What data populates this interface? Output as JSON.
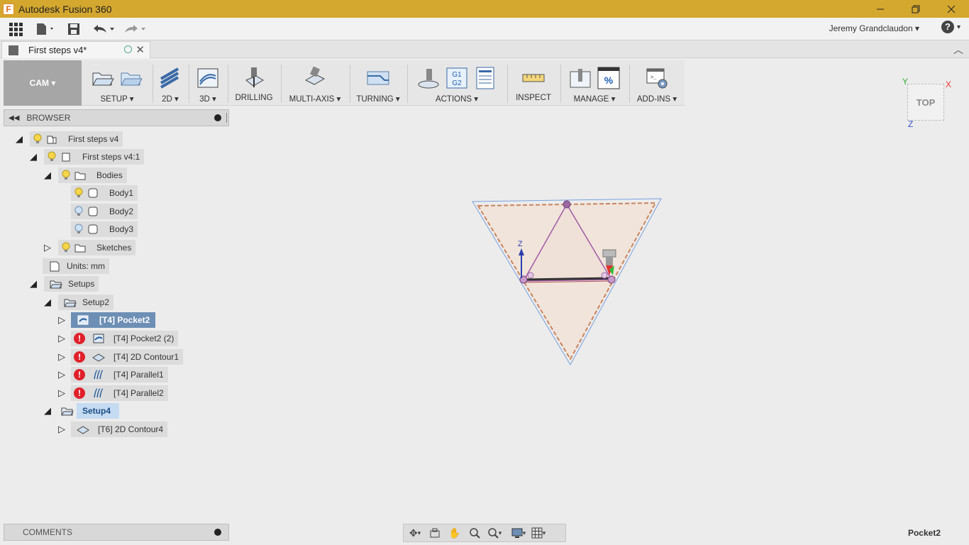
{
  "window": {
    "app_title": "Autodesk Fusion 360",
    "app_icon_letter": "F"
  },
  "quick_access": {
    "user_name": "Jeremy Grandclaudon",
    "help_label": "?"
  },
  "document_tab": {
    "name": "First steps v4*"
  },
  "toolbar": {
    "workspace": "CAM",
    "groups": [
      "SETUP",
      "2D",
      "3D",
      "DRILLING",
      "MULTI-AXIS",
      "TURNING",
      "ACTIONS",
      "INSPECT",
      "MANAGE",
      "ADD-INS"
    ],
    "actions_code": "G1\nG2",
    "manage_percent": "%"
  },
  "browser": {
    "title": "BROWSER",
    "items": [
      {
        "label": "First steps v4"
      },
      {
        "label": "First steps v4:1"
      },
      {
        "label": "Bodies"
      },
      {
        "label": "Body1"
      },
      {
        "label": "Body2"
      },
      {
        "label": "Body3"
      },
      {
        "label": "Sketches"
      },
      {
        "label": "Units: mm"
      },
      {
        "label": "Setups"
      },
      {
        "label": "Setup2"
      },
      {
        "label": "[T4] Pocket2"
      },
      {
        "label": "[T4] Pocket2 (2)"
      },
      {
        "label": "[T4] 2D Contour1"
      },
      {
        "label": "[T4] Parallel1"
      },
      {
        "label": "[T4] Parallel2"
      },
      {
        "label": "Setup4"
      },
      {
        "label": "[T6] 2D Contour4"
      }
    ]
  },
  "comments": {
    "title": "COMMENTS"
  },
  "viewcube": {
    "face": "TOP",
    "axis_x": "X",
    "axis_y": "Y",
    "axis_z": "Z"
  },
  "viewport": {
    "axis_z_label": "Z"
  },
  "status": {
    "selected_operation": "Pocket2"
  },
  "colors": {
    "titlebar": "#d4a72e",
    "selected_row": "#6d8fb5",
    "active_setup": "#c5dbf2",
    "error": "#e0202a"
  }
}
